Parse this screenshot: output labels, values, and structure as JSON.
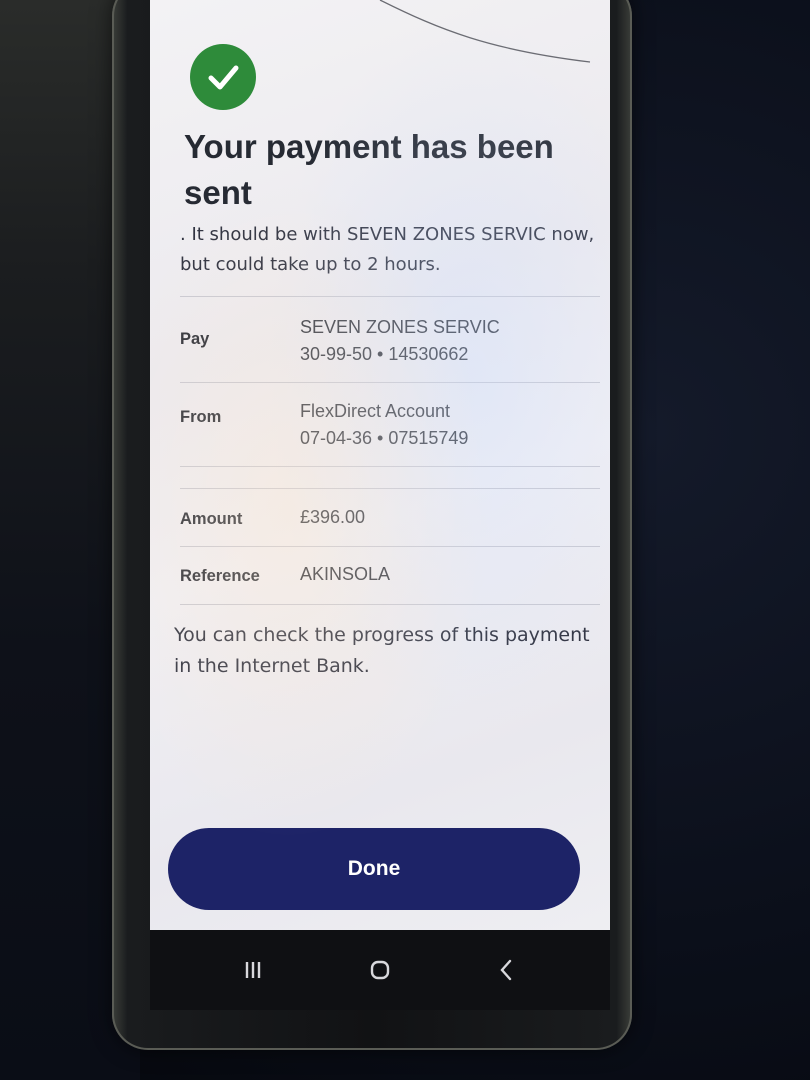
{
  "status": {
    "title": "Your payment has been sent",
    "subtitle": ". It should be with SEVEN ZONES SERVIC now, but could take up to 2 hours."
  },
  "details": {
    "pay_label": "Pay",
    "pay_name": "SEVEN ZONES SERVIC",
    "pay_account": "30-99-50 • 14530662",
    "from_label": "From",
    "from_name": "FlexDirect Account",
    "from_account": "07-04-36 • 07515749",
    "amount_label": "Amount",
    "amount_value": "£396.00",
    "reference_label": "Reference",
    "reference_value": "AKINSOLA"
  },
  "note": "You can check the progress of this payment in the Internet Bank.",
  "actions": {
    "done_label": "Done"
  },
  "navbar": {
    "recent_icon": "recent-apps-icon",
    "home_icon": "home-icon",
    "back_icon": "back-icon"
  },
  "colors": {
    "success": "#2e8b3a",
    "button": "#1d2367"
  }
}
